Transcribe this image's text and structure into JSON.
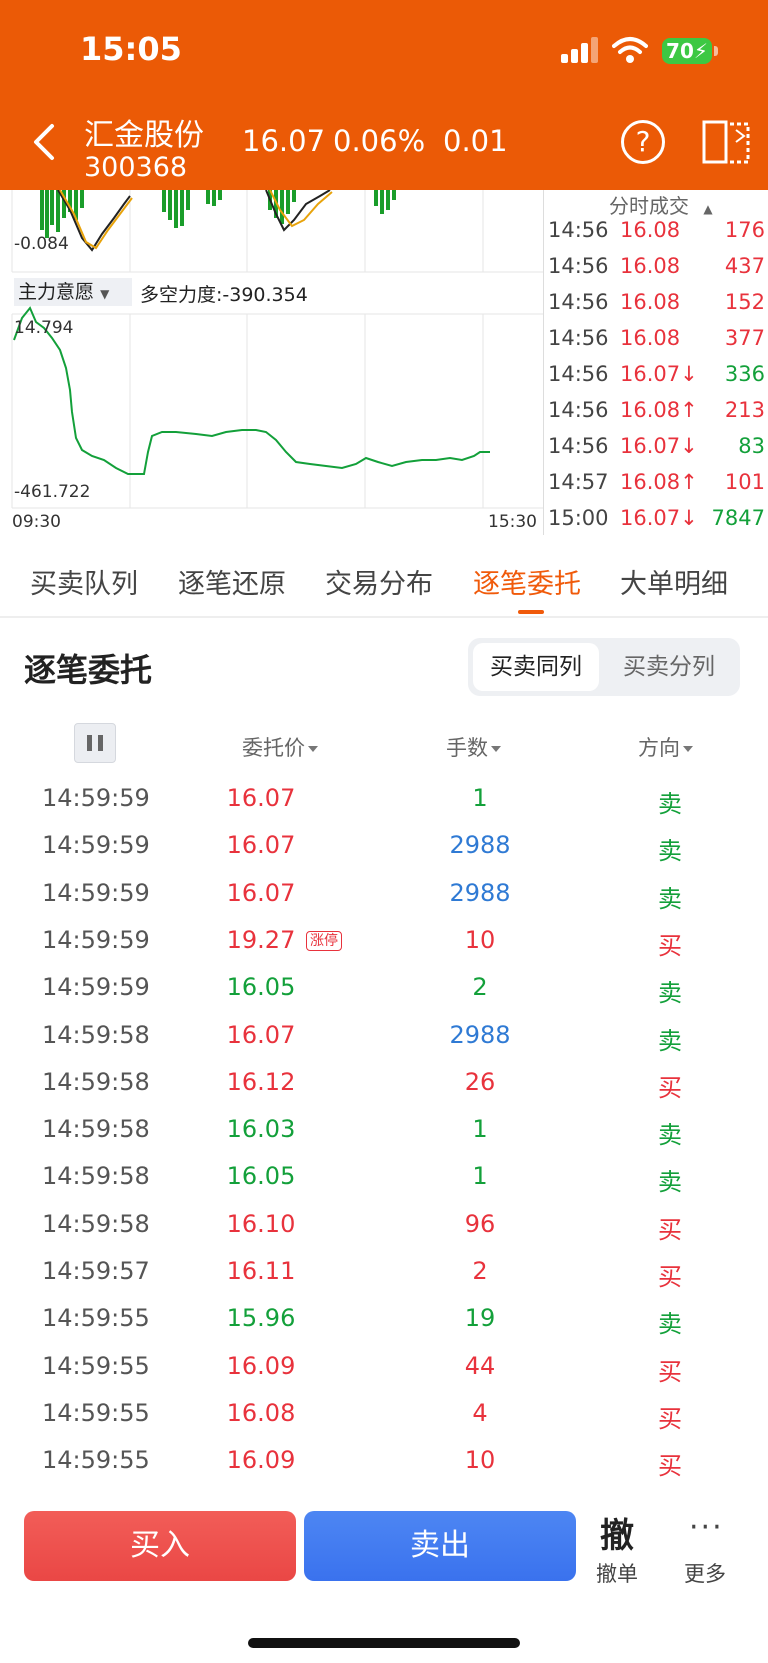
{
  "status_bar": {
    "time": "15:05",
    "battery": "70"
  },
  "header": {
    "stock_name": "汇金股份",
    "stock_code": "300368",
    "price": "16.07",
    "change_pct": "0.06%",
    "change": "0.01"
  },
  "chart": {
    "upper_min_label": "-0.084",
    "indicator_name": "主力意愿",
    "force_label": "多空力度:-390.354",
    "lower_max_label": "14.794",
    "lower_min_label": "-461.722",
    "time_start": "09:30",
    "time_end": "15:30",
    "colors": {
      "green": "#13a03a",
      "red": "#e8323c",
      "blue": "#2f7ad4",
      "accent": "#eb5a06"
    }
  },
  "ticker": {
    "header": "分时成交",
    "rows": [
      {
        "time": "14:56",
        "price": "16.08",
        "vol": "176",
        "price_color": "red",
        "vol_color": "red"
      },
      {
        "time": "14:56",
        "price": "16.08",
        "vol": "437",
        "price_color": "red",
        "vol_color": "red"
      },
      {
        "time": "14:56",
        "price": "16.08",
        "vol": "152",
        "price_color": "red",
        "vol_color": "red"
      },
      {
        "time": "14:56",
        "price": "16.08",
        "vol": "377",
        "price_color": "red",
        "vol_color": "red"
      },
      {
        "time": "14:56",
        "price": "16.07↓",
        "vol": "336",
        "price_color": "red",
        "vol_color": "green"
      },
      {
        "time": "14:56",
        "price": "16.08↑",
        "vol": "213",
        "price_color": "red",
        "vol_color": "red"
      },
      {
        "time": "14:56",
        "price": "16.07↓",
        "vol": "83",
        "price_color": "red",
        "vol_color": "green"
      },
      {
        "time": "14:57",
        "price": "16.08↑",
        "vol": "101",
        "price_color": "red",
        "vol_color": "red"
      },
      {
        "time": "15:00",
        "price": "16.07↓",
        "vol": "7847",
        "price_color": "red",
        "vol_color": "green"
      }
    ]
  },
  "tabs": [
    "买卖队列",
    "逐笔还原",
    "交易分布",
    "逐笔委托",
    "大单明细"
  ],
  "active_tab": 3,
  "section": {
    "title": "逐笔委托",
    "segment_left": "买卖同列",
    "segment_right": "买卖分列"
  },
  "table": {
    "headers": {
      "price": "委托价",
      "qty": "手数",
      "dir": "方向"
    },
    "limit_badge": "涨停",
    "rows": [
      {
        "time": "14:59:59",
        "price": "16.07",
        "qty": "1",
        "dir": "卖",
        "price_color": "red",
        "qty_color": "green",
        "dir_color": "green"
      },
      {
        "time": "14:59:59",
        "price": "16.07",
        "qty": "2988",
        "dir": "卖",
        "price_color": "red",
        "qty_color": "blue",
        "dir_color": "green"
      },
      {
        "time": "14:59:59",
        "price": "16.07",
        "qty": "2988",
        "dir": "卖",
        "price_color": "red",
        "qty_color": "blue",
        "dir_color": "green"
      },
      {
        "time": "14:59:59",
        "price": "19.27",
        "qty": "10",
        "dir": "买",
        "price_color": "red",
        "qty_color": "red",
        "dir_color": "red",
        "badge": true
      },
      {
        "time": "14:59:59",
        "price": "16.05",
        "qty": "2",
        "dir": "卖",
        "price_color": "green",
        "qty_color": "green",
        "dir_color": "green"
      },
      {
        "time": "14:59:58",
        "price": "16.07",
        "qty": "2988",
        "dir": "卖",
        "price_color": "red",
        "qty_color": "blue",
        "dir_color": "green"
      },
      {
        "time": "14:59:58",
        "price": "16.12",
        "qty": "26",
        "dir": "买",
        "price_color": "red",
        "qty_color": "red",
        "dir_color": "red"
      },
      {
        "time": "14:59:58",
        "price": "16.03",
        "qty": "1",
        "dir": "卖",
        "price_color": "green",
        "qty_color": "green",
        "dir_color": "green"
      },
      {
        "time": "14:59:58",
        "price": "16.05",
        "qty": "1",
        "dir": "卖",
        "price_color": "green",
        "qty_color": "green",
        "dir_color": "green"
      },
      {
        "time": "14:59:58",
        "price": "16.10",
        "qty": "96",
        "dir": "买",
        "price_color": "red",
        "qty_color": "red",
        "dir_color": "red"
      },
      {
        "time": "14:59:57",
        "price": "16.11",
        "qty": "2",
        "dir": "买",
        "price_color": "red",
        "qty_color": "red",
        "dir_color": "red"
      },
      {
        "time": "14:59:55",
        "price": "15.96",
        "qty": "19",
        "dir": "卖",
        "price_color": "green",
        "qty_color": "green",
        "dir_color": "green"
      },
      {
        "time": "14:59:55",
        "price": "16.09",
        "qty": "44",
        "dir": "买",
        "price_color": "red",
        "qty_color": "red",
        "dir_color": "red"
      },
      {
        "time": "14:59:55",
        "price": "16.08",
        "qty": "4",
        "dir": "买",
        "price_color": "red",
        "qty_color": "red",
        "dir_color": "red"
      },
      {
        "time": "14:59:55",
        "price": "16.09",
        "qty": "10",
        "dir": "买",
        "price_color": "red",
        "qty_color": "red",
        "dir_color": "red"
      }
    ]
  },
  "bottom": {
    "buy": "买入",
    "sell": "卖出",
    "cancel_icon": "撤",
    "cancel_label": "撤单",
    "more_icon": "···",
    "more_label": "更多"
  }
}
